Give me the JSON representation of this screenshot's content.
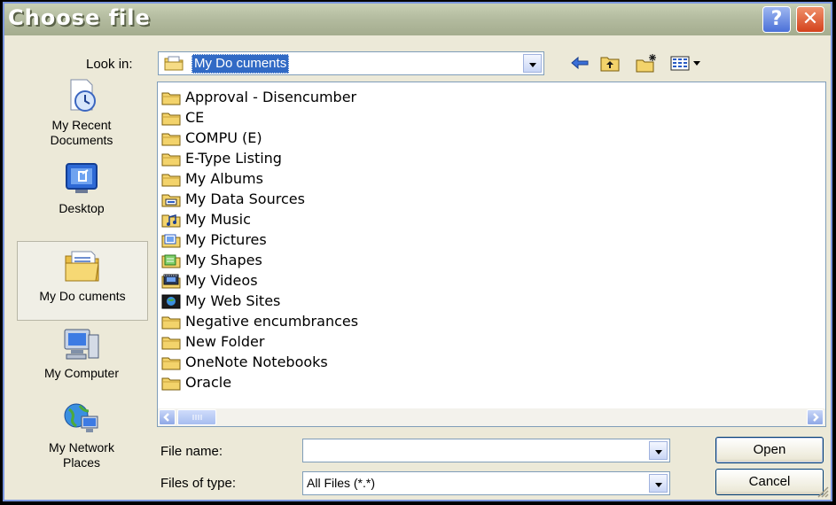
{
  "window": {
    "title": "Choose file",
    "help_label": "?",
    "close_label": "✕"
  },
  "lookin": {
    "label": "Look in:",
    "value": "My Do cuments"
  },
  "toolbar": {
    "icons": [
      "back-arrow-icon",
      "up-folder-icon",
      "new-folder-icon",
      "view-menu-icon"
    ]
  },
  "places": [
    {
      "name": "my-recent-documents",
      "label_lines": [
        "My Recent",
        "Documents"
      ],
      "icon": "recent-documents-icon"
    },
    {
      "name": "desktop",
      "label_lines": [
        "Desktop"
      ],
      "icon": "desktop-icon"
    },
    {
      "name": "my-documents",
      "label_lines": [
        "My Do cuments"
      ],
      "icon": "my-documents-icon",
      "selected": true
    },
    {
      "name": "my-computer",
      "label_lines": [
        "My Computer"
      ],
      "icon": "computer-icon"
    },
    {
      "name": "my-network-places",
      "label_lines": [
        "My Network",
        "Places"
      ],
      "icon": "network-places-icon"
    }
  ],
  "files": [
    {
      "name": "Approval - Disencumber",
      "icon": "folder-icon"
    },
    {
      "name": "CE",
      "icon": "folder-icon"
    },
    {
      "name": "COMPU (E)",
      "icon": "folder-icon"
    },
    {
      "name": "E-Type Listing",
      "icon": "folder-icon"
    },
    {
      "name": "My Albums",
      "icon": "folder-icon"
    },
    {
      "name": "My Data Sources",
      "icon": "data-sources-icon"
    },
    {
      "name": "My Music",
      "icon": "music-folder-icon"
    },
    {
      "name": "My Pictures",
      "icon": "pictures-folder-icon"
    },
    {
      "name": "My Shapes",
      "icon": "shapes-folder-icon"
    },
    {
      "name": "My Videos",
      "icon": "videos-folder-icon"
    },
    {
      "name": "My Web Sites",
      "icon": "web-sites-icon"
    },
    {
      "name": "Negative encumbrances",
      "icon": "folder-icon"
    },
    {
      "name": "New Folder",
      "icon": "folder-icon"
    },
    {
      "name": "OneNote Notebooks",
      "icon": "folder-icon"
    },
    {
      "name": "Oracle",
      "icon": "folder-icon"
    }
  ],
  "filename": {
    "label": "File name:",
    "value": ""
  },
  "filetype": {
    "label": "Files of type:",
    "value": "All Files (*.*)"
  },
  "buttons": {
    "open": "Open",
    "cancel": "Cancel"
  },
  "colors": {
    "selection": "#316ac5",
    "dialog_bg": "#ece9d8",
    "folder_yellow": "#f3d36b"
  }
}
